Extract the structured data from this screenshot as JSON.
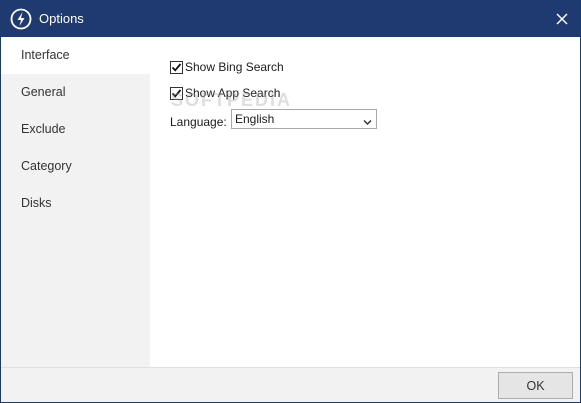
{
  "window": {
    "title": "Options",
    "colors": {
      "titlebar": "#1e3a70",
      "sidebar": "#f2f2f2",
      "footer": "#f2f2f2"
    }
  },
  "sidebar": {
    "items": [
      {
        "label": "Interface",
        "active": true
      },
      {
        "label": "General",
        "active": false
      },
      {
        "label": "Exclude",
        "active": false
      },
      {
        "label": "Category",
        "active": false
      },
      {
        "label": "Disks",
        "active": false
      }
    ]
  },
  "interface": {
    "show_bing": {
      "label": "Show Bing Search",
      "checked": true
    },
    "show_app": {
      "label": "Show App Search",
      "checked": true
    },
    "language": {
      "label": "Language:",
      "value": "English"
    }
  },
  "watermark": "SOFTPEDIA",
  "footer": {
    "ok_label": "OK"
  },
  "icons": {
    "app": "lightning-icon",
    "close": "close-icon",
    "check": "checkmark-icon",
    "dropdown": "chevron-down-icon"
  }
}
